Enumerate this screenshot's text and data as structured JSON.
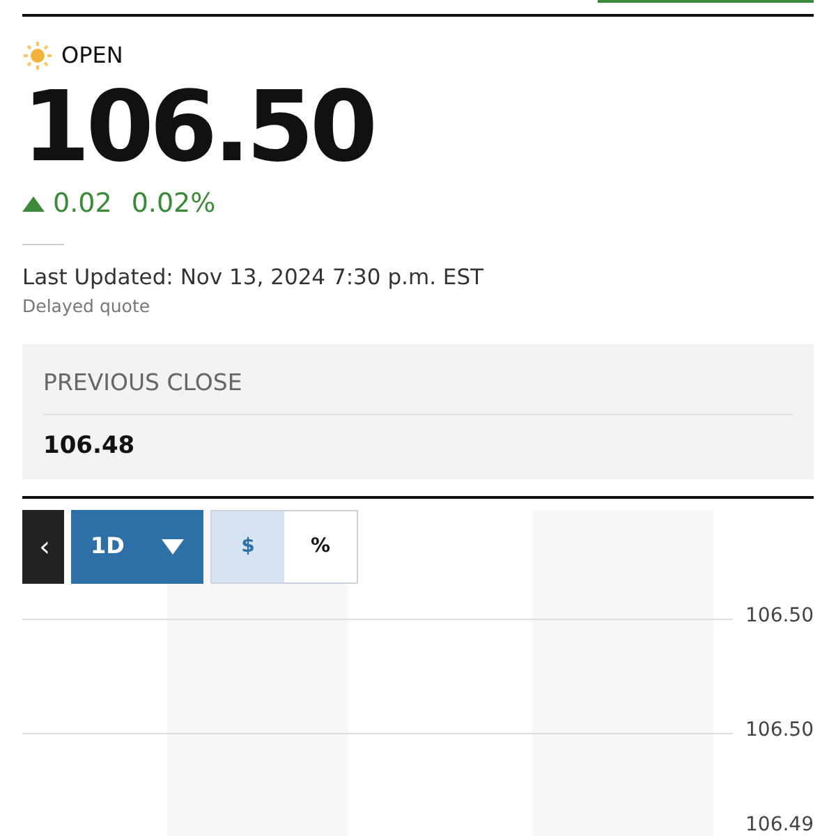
{
  "market_status": {
    "label": "OPEN",
    "kind": "day"
  },
  "price": "106.50",
  "change": {
    "rising": true,
    "amount": "0.02",
    "percent": "0.02%"
  },
  "last_updated": "Last Updated: Nov 13, 2024 7:30 p.m. EST",
  "quote_note": "Delayed quote",
  "previous_close": {
    "label": "PREVIOUS CLOSE",
    "value": "106.48"
  },
  "chart_controls": {
    "back": "‹",
    "range": "1D",
    "units": [
      {
        "label": "$",
        "selected": true
      },
      {
        "label": "%",
        "selected": false
      }
    ]
  },
  "y_axis_labels": [
    "106.50",
    "106.50",
    "106.49"
  ]
}
